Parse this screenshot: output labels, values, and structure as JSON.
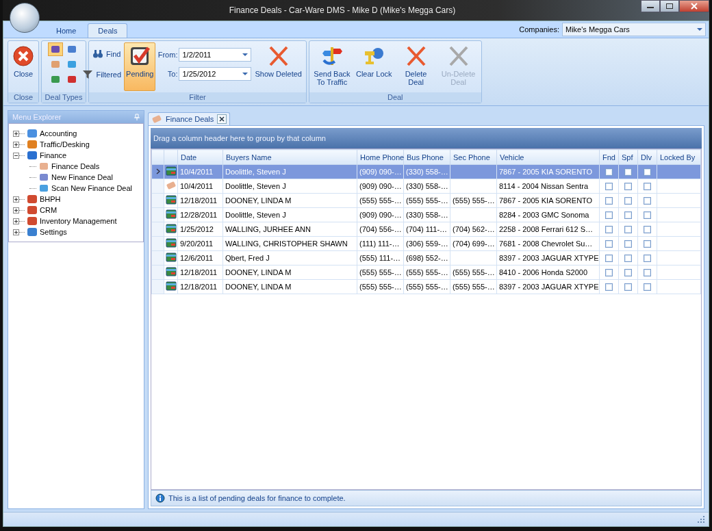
{
  "window": {
    "title": "Finance Deals - Car-Ware DMS - Mike D (Mike's Megga Cars)"
  },
  "ribbon_tabs": [
    {
      "label": "Home",
      "selected": false
    },
    {
      "label": "Deals",
      "selected": true
    }
  ],
  "companies": {
    "label": "Companies:",
    "value": "Mike's Megga Cars"
  },
  "ribbon_groups": [
    {
      "title": "Close",
      "items": [
        {
          "kind": "close",
          "label": "Close"
        }
      ]
    },
    {
      "title": "Deal Types",
      "items": [
        {
          "kind": "types",
          "selected": [
            true,
            false,
            false,
            false,
            false,
            false
          ]
        }
      ]
    },
    {
      "title": "Filter",
      "items": [
        {
          "kind": "find",
          "label": "Find"
        },
        {
          "kind": "filtered",
          "label": "Filtered"
        },
        {
          "kind": "pending",
          "label": "Pending",
          "selected": true
        },
        {
          "kind": "dates",
          "from_label": "From:",
          "from": "1/2/2011",
          "to_label": "To:",
          "to": "1/25/2012"
        },
        {
          "kind": "show_deleted",
          "label": "Show Deleted"
        }
      ]
    },
    {
      "title": "Deal",
      "items": [
        {
          "kind": "send_back",
          "label": "Send Back To Traffic",
          "disabled": false
        },
        {
          "kind": "clear_lock",
          "label": "Clear Lock",
          "disabled": false
        },
        {
          "kind": "delete",
          "label": "Delete Deal",
          "disabled": false
        },
        {
          "kind": "undelete",
          "label": "Un-Delete Deal",
          "disabled": true
        }
      ]
    }
  ],
  "menu_explorer": {
    "title": "Menu Explorer",
    "items": [
      {
        "label": "Accounting",
        "kind": "calc",
        "expanded": false
      },
      {
        "label": "Traffic/Desking",
        "kind": "sign",
        "expanded": false
      },
      {
        "label": "Finance",
        "kind": "dollar",
        "expanded": true,
        "children": [
          {
            "label": "Finance Deals",
            "kind": "tag"
          },
          {
            "label": "New Finance Deal",
            "kind": "person"
          },
          {
            "label": "Scan New Finance Deal",
            "kind": "scan"
          }
        ]
      },
      {
        "label": "BHPH",
        "kind": "hands",
        "expanded": false
      },
      {
        "label": "CRM",
        "kind": "crm",
        "expanded": false
      },
      {
        "label": "Inventory Management",
        "kind": "car",
        "expanded": false
      },
      {
        "label": "Settings",
        "kind": "gear",
        "expanded": false
      }
    ]
  },
  "document_tab": {
    "label": "Finance Deals"
  },
  "grid": {
    "group_hint": "Drag a column header here to group by that column",
    "columns": [
      "Date",
      "Buyers Name",
      "Home Phone",
      "Bus Phone",
      "Sec Phone",
      "Vehicle",
      "Fnd",
      "Spf",
      "Dlv",
      "Locked By"
    ],
    "rows": [
      {
        "selected": true,
        "kind": "card",
        "cells": [
          "10/4/2011",
          "Doolittle, Steven J",
          "(909) 090-…",
          "(330) 558-…",
          "",
          "7867 - 2005 KIA SORENTO"
        ],
        "fnd": false,
        "spf": false,
        "dlv": false
      },
      {
        "selected": false,
        "kind": "tag",
        "cells": [
          "10/4/2011",
          "Doolittle, Steven J",
          "(909) 090-…",
          "(330) 558-…",
          "",
          "8114 - 2004 Nissan Sentra"
        ],
        "fnd": false,
        "spf": false,
        "dlv": false
      },
      {
        "selected": false,
        "kind": "card",
        "cells": [
          "12/18/2011",
          "DOONEY, LINDA M",
          "(555) 555-…",
          "(555) 555-…",
          "(555) 555-…",
          "7867 - 2005 KIA SORENTO"
        ],
        "fnd": false,
        "spf": false,
        "dlv": false
      },
      {
        "selected": false,
        "kind": "card",
        "cells": [
          "12/28/2011",
          "Doolittle, Steven J",
          "(909) 090-…",
          "(330) 558-…",
          "",
          "8284 - 2003 GMC Sonoma"
        ],
        "fnd": false,
        "spf": false,
        "dlv": false
      },
      {
        "selected": false,
        "kind": "card",
        "cells": [
          "1/25/2012",
          "WALLING, JURHEE ANN",
          "(704) 556-…",
          "(704) 111-…",
          "(704) 562-…",
          "2258 - 2008 Ferrari 612 S…"
        ],
        "fnd": false,
        "spf": false,
        "dlv": false
      },
      {
        "selected": false,
        "kind": "card",
        "cells": [
          "9/20/2011",
          "WALLING, CHRISTOPHER SHAWN",
          "(111) 111-…",
          "(306) 559-…",
          "(704) 699-…",
          "7681 - 2008 Chevrolet Su…"
        ],
        "fnd": false,
        "spf": false,
        "dlv": false
      },
      {
        "selected": false,
        "kind": "card",
        "cells": [
          "12/6/2011",
          "Qbert, Fred J",
          "(555) 111-…",
          "(698) 552-…",
          "",
          "8397 - 2003 JAGUAR XTYPE"
        ],
        "fnd": false,
        "spf": false,
        "dlv": false
      },
      {
        "selected": false,
        "kind": "card",
        "cells": [
          "12/18/2011",
          "DOONEY, LINDA M",
          "(555) 555-…",
          "(555) 555-…",
          "(555) 555-…",
          "8410 - 2006 Honda S2000"
        ],
        "fnd": false,
        "spf": false,
        "dlv": false
      },
      {
        "selected": false,
        "kind": "card",
        "cells": [
          "12/18/2011",
          "DOONEY, LINDA M",
          "(555) 555-…",
          "(555) 555-…",
          "(555) 555-…",
          "8397 - 2003 JAGUAR XTYPE"
        ],
        "fnd": false,
        "spf": false,
        "dlv": false
      }
    ]
  },
  "info_bar": {
    "text": "This is a list of pending deals for finance to complete."
  }
}
